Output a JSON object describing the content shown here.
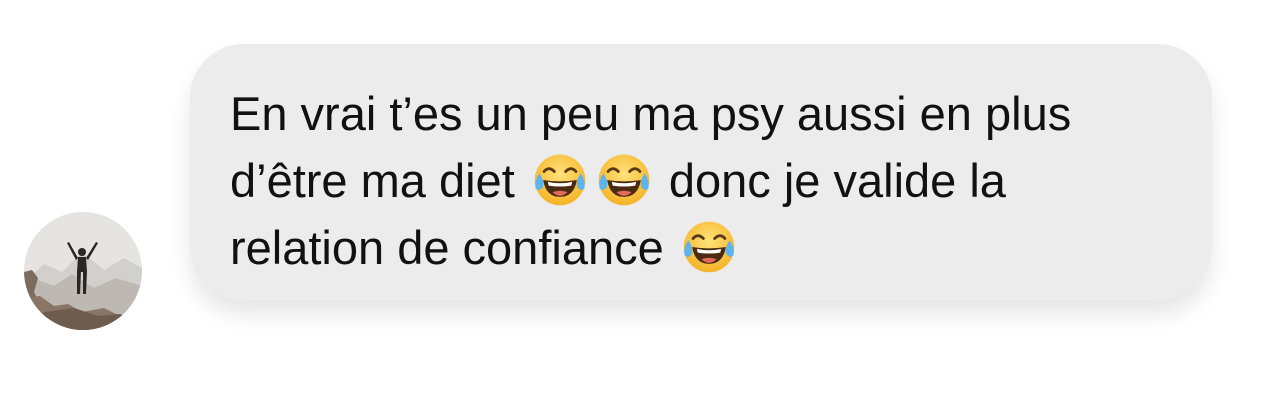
{
  "conversation": {
    "message": {
      "text_line1": "En vrai t’es un peu ma psy aussi en plus",
      "text_line2_a": "d’être ma diet ",
      "text_line2_b": " donc je valide la",
      "text_line3_a": "relation de confiance ",
      "emoji_name": "face-with-tears-of-joy-icon"
    }
  },
  "colors": {
    "bubble_bg": "#ececec",
    "text": "#111111",
    "page_bg": "#ffffff"
  }
}
